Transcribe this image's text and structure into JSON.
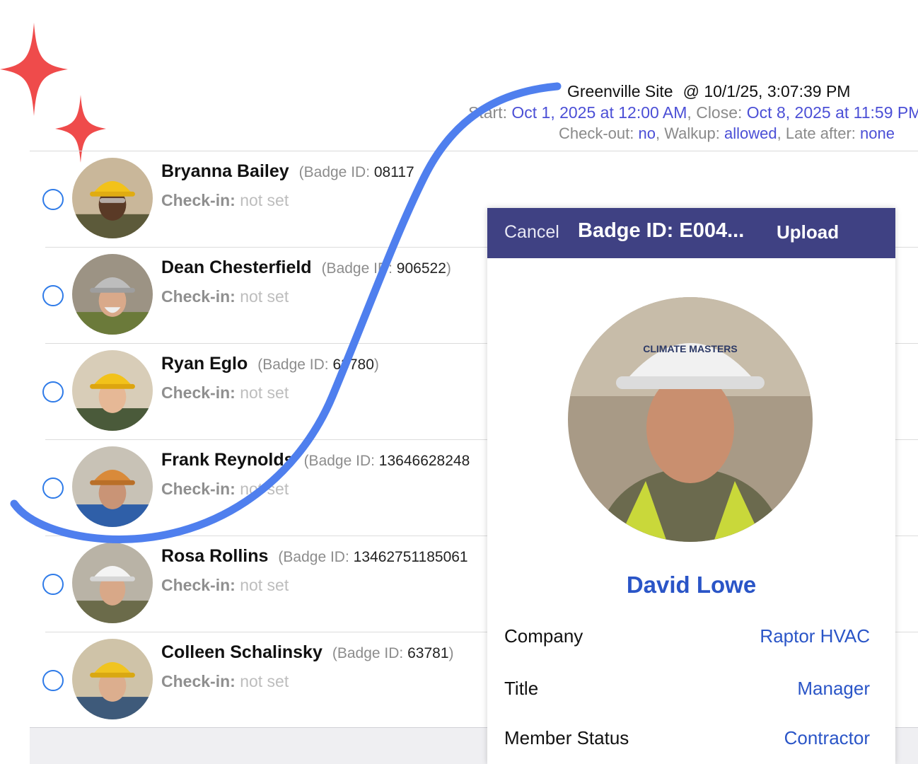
{
  "colors": {
    "accent": "#4b4fd6",
    "link": "#2a55c7",
    "modal_bar": "#3f4183",
    "radio": "#2f7be8",
    "sparkle": "#ef4b4b",
    "curve": "#4f7fee"
  },
  "header": {
    "site": "Greenville Site",
    "timestamp": "@ 10/1/25, 3:07:39 PM",
    "start_label": "Start:",
    "start_value": "Oct 1, 2025 at 12:00 AM",
    "close_label": "Close:",
    "close_value": "Oct 8, 2025 at 11:59 PM",
    "checkout_label": "Check-out:",
    "checkout_value": "no",
    "walkup_label": "Walkup:",
    "walkup_value": "allowed",
    "late_label": "Late after:",
    "late_value": "none"
  },
  "members": [
    {
      "name": "Bryanna Bailey",
      "badge_label": "(Badge ID:",
      "badge_id": "08117",
      "checkin_label": "Check-in:",
      "checkin_value": "not set"
    },
    {
      "name": "Dean Chesterfield",
      "badge_label": "(Badge ID:",
      "badge_id": "906522",
      "checkin_label": "Check-in:",
      "checkin_value": "not set"
    },
    {
      "name": "Ryan Eglo",
      "badge_label": "(Badge ID:",
      "badge_id": "63780",
      "checkin_label": "Check-in:",
      "checkin_value": "not set"
    },
    {
      "name": "Frank Reynolds",
      "badge_label": "(Badge ID:",
      "badge_id": "13646628248",
      "checkin_label": "Check-in:",
      "checkin_value": "not set"
    },
    {
      "name": "Rosa Rollins",
      "badge_label": "(Badge ID:",
      "badge_id": "13462751185061",
      "checkin_label": "Check-in:",
      "checkin_value": "not set"
    },
    {
      "name": "Colleen Schalinsky",
      "badge_label": "(Badge ID:",
      "badge_id": "63781",
      "checkin_label": "Check-in:",
      "checkin_value": "not set"
    }
  ],
  "modal": {
    "cancel": "Cancel",
    "title": "Badge ID: E004...",
    "upload": "Upload",
    "full_name": "David Lowe",
    "helmet_logo_text": "CLIMATE MASTERS",
    "fields": [
      {
        "label": "Company",
        "value": "Raptor HVAC"
      },
      {
        "label": "Title",
        "value": "Manager"
      },
      {
        "label": "Member Status",
        "value": "Contractor"
      }
    ]
  }
}
